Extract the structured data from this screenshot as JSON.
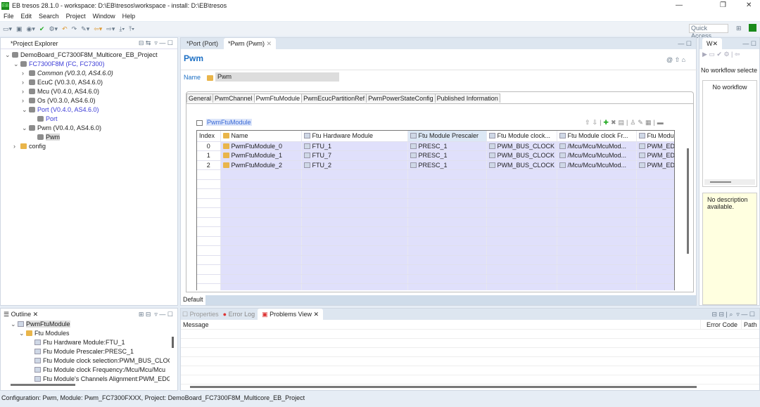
{
  "window": {
    "title": "EB tresos 28.1.0 - workspace: D:\\EB\\tresos\\workspace - install: D:\\EB\\tresos",
    "logo": "EB"
  },
  "menu": [
    "File",
    "Edit",
    "Search",
    "Project",
    "Window",
    "Help"
  ],
  "toolbar": {
    "quick_access": "Quick Access"
  },
  "project_explorer": {
    "title": "*Project Explorer",
    "items": [
      {
        "label": "DemoBoard_FC7300F8M_Multicore_EB_Project",
        "level": 0,
        "expanded": true
      },
      {
        "label": "FC7300F8M (FC, FC7300)",
        "level": 1,
        "expanded": true,
        "color": "#3a3ad6"
      },
      {
        "label": "Common (V0.3.0, AS4.6.0)",
        "level": 2,
        "expanded": false,
        "italic": true
      },
      {
        "label": "EcuC (V0.3.0, AS4.6.0)",
        "level": 2,
        "expanded": false
      },
      {
        "label": "Mcu (V0.4.0, AS4.6.0)",
        "level": 2,
        "expanded": false
      },
      {
        "label": "Os (V0.3.0, AS4.6.0)",
        "level": 2,
        "expanded": false
      },
      {
        "label": "Port (V0.4.0, AS4.6.0)",
        "level": 2,
        "expanded": true,
        "color": "#3a3ad6"
      },
      {
        "label": "Port",
        "level": 3,
        "color": "#3a3ad6"
      },
      {
        "label": "Pwm (V0.4.0, AS4.6.0)",
        "level": 2,
        "expanded": true
      },
      {
        "label": "Pwm",
        "level": 3,
        "selected": true
      },
      {
        "label": "config",
        "level": 1,
        "expanded": false,
        "folder": true
      }
    ]
  },
  "editor": {
    "tabs": [
      {
        "label": "*Port (Port)"
      },
      {
        "label": "*Pwm (Pwm)",
        "active": true
      }
    ],
    "heading": "Pwm",
    "name_label": "Name",
    "name_value": "Pwm",
    "subtabs": [
      "General",
      "PwmChannel",
      "PwmFtuModule",
      "PwmEcucPartitionRef",
      "PwmPowerStateConfig",
      "Published Information"
    ],
    "active_subtab": "PwmFtuModule",
    "table_title": "PwmFtuModule",
    "columns": [
      "Index",
      "Name",
      "Ftu Hardware Module",
      "Ftu Module Prescaler",
      "Ftu Module clock...",
      "Ftu Module clock Fr...",
      "Ftu Modu"
    ],
    "rows": [
      [
        "0",
        "PwmFtuModule_0",
        "FTU_1",
        "PRESC_1",
        "PWM_BUS_CLOCK",
        "/Mcu/Mcu/McuMod...",
        "PWM_EDG"
      ],
      [
        "1",
        "PwmFtuModule_1",
        "FTU_7",
        "PRESC_1",
        "PWM_BUS_CLOCK",
        "/Mcu/Mcu/McuMod...",
        "PWM_EDG"
      ],
      [
        "2",
        "PwmFtuModule_2",
        "FTU_2",
        "PRESC_1",
        "PWM_BUS_CLOCK",
        "/Mcu/Mcu/McuMod...",
        "PWM_EDG"
      ]
    ],
    "bottom_tab": "Default"
  },
  "workflow": {
    "tab": "W",
    "none_selected": "No workflow selecte",
    "none": "No workflow",
    "description": "No description available."
  },
  "outline": {
    "title": "Outline",
    "items": [
      {
        "label": "PwmFtuModule",
        "level": 0
      },
      {
        "label": "Ftu Modules",
        "level": 1
      },
      {
        "label": "Ftu Hardware Module:FTU_1",
        "level": 2
      },
      {
        "label": "Ftu Module Prescaler:PRESC_1",
        "level": 2
      },
      {
        "label": "Ftu Module clock selection:PWM_BUS_CLOC",
        "level": 2
      },
      {
        "label": "Ftu Module clock Frequency:/Mcu/Mcu/Mcu",
        "level": 2
      },
      {
        "label": "Ftu Module's Channels Alignment:PWM_EDG",
        "level": 2
      }
    ]
  },
  "problems": {
    "tabs": [
      "Properties",
      "Error Log",
      "Problems View"
    ],
    "columns": [
      "Message",
      "Error Code",
      "Path"
    ]
  },
  "status": "Configuration: Pwm, Module: Pwm_FC7300FXXX, Project: DemoBoard_FC7300F8M_Multicore_EB_Project"
}
